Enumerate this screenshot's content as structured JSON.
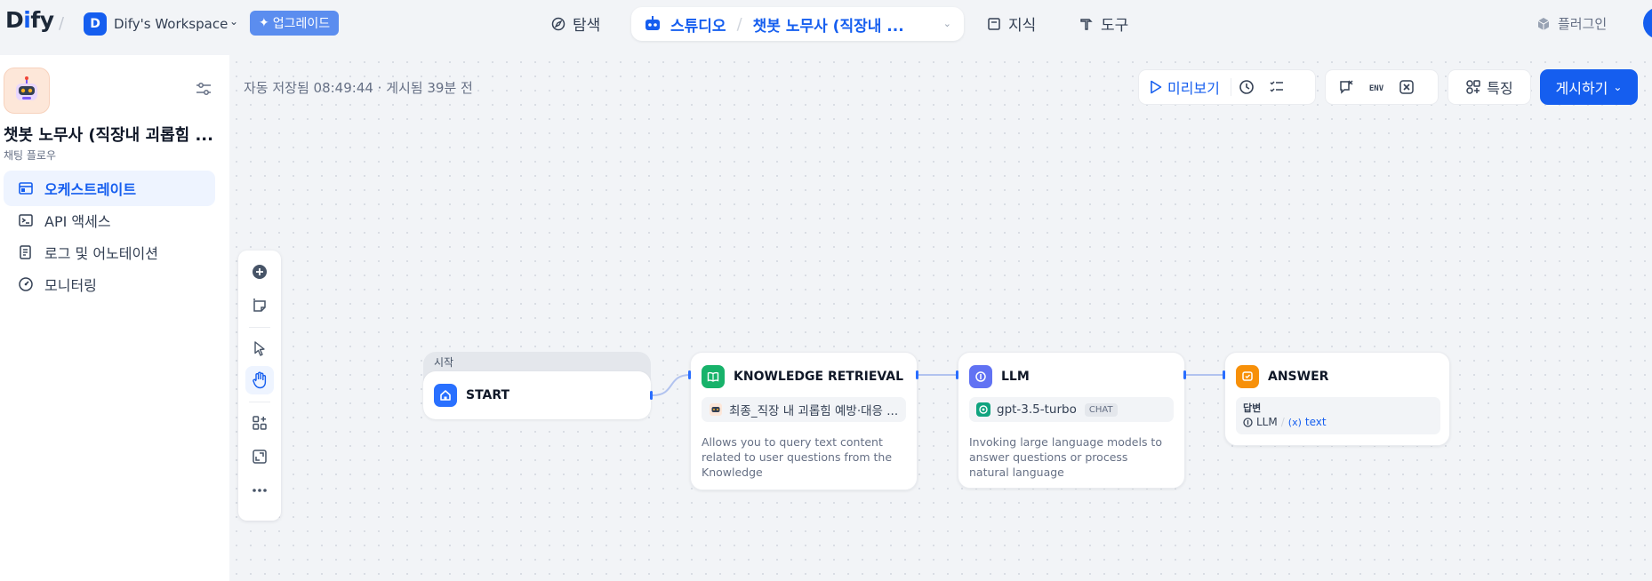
{
  "brand": {
    "logo_prefix": "D",
    "logo_i": "i",
    "logo_suffix": "fy"
  },
  "workspace": {
    "initial": "D",
    "name": "Dify's Workspace",
    "upgrade_label": "업그레이드"
  },
  "nav": {
    "explore": "탐색",
    "studio": "스튜디오",
    "current_app": "챗봇 노무사 (직장내 ...",
    "knowledge": "지식",
    "tools": "도구",
    "plugins": "플러그인"
  },
  "sidebar": {
    "app_title": "챗봇 노무사 (직장내 괴롭힘 ...",
    "app_type": "채팅 플로우",
    "items": [
      {
        "label": "오케스트레이트",
        "icon": "layout-icon",
        "active": true
      },
      {
        "label": "API 액세스",
        "icon": "terminal-icon",
        "active": false
      },
      {
        "label": "로그 및 어노테이션",
        "icon": "log-icon",
        "active": false
      },
      {
        "label": "모니터링",
        "icon": "gauge-icon",
        "active": false
      }
    ]
  },
  "header": {
    "status": "자동 저장됨 08:49:44 · 게시됨 39분 전",
    "preview_label": "미리보기",
    "env_label": "ENV",
    "feature_label": "특징",
    "publish_label": "게시하기"
  },
  "nodes": {
    "start": {
      "group_label": "시작",
      "title": "START"
    },
    "knowledge": {
      "title": "KNOWLEDGE RETRIEVAL",
      "dataset": "최종_직장 내 괴롭힘 예방·대응 ...",
      "description": "Allows you to query text content related to user questions from the Knowledge"
    },
    "llm": {
      "title": "LLM",
      "model": "gpt-3.5-turbo",
      "mode": "CHAT",
      "description": "Invoking large language models to answer questions or process natural language"
    },
    "answer": {
      "title": "ANSWER",
      "field_label": "답변",
      "var_source": "LLM",
      "var_prefix": "(x)",
      "var_name": "text"
    }
  },
  "colors": {
    "accent": "#155EEF",
    "knowledge_badge": "#17B26A",
    "llm_badge": "#6172F3",
    "answer_badge": "#F79009",
    "start_badge": "#2970FF"
  }
}
